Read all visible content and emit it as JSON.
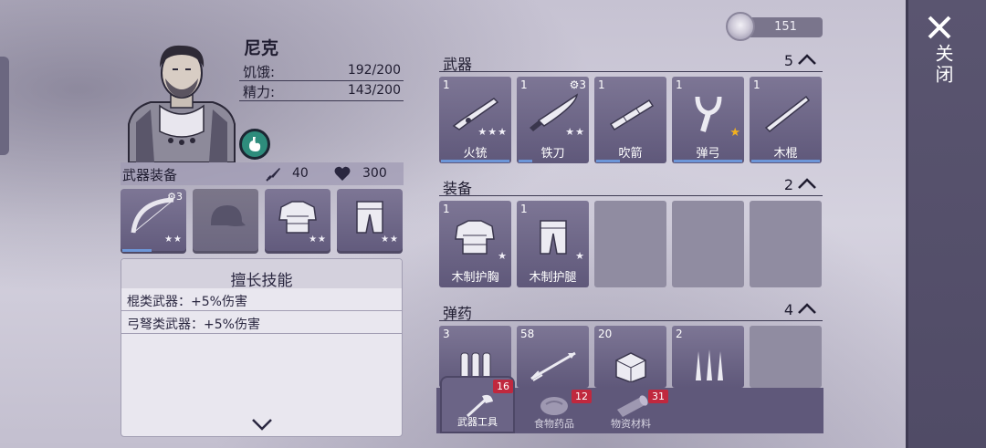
{
  "character": {
    "name": "尼克",
    "hunger_label": "饥饿:",
    "hunger_value": "192/200",
    "energy_label": "精力:",
    "energy_value": "143/200"
  },
  "equipment": {
    "title": "武器装备",
    "attack": "40",
    "health": "300",
    "slots": [
      {
        "name": "bow",
        "icon": "bow-icon",
        "gear_level": "3",
        "stars": 2,
        "durability": 0.45
      },
      {
        "name": "cap",
        "icon": "cap-icon",
        "empty": true
      },
      {
        "name": "chest-armor",
        "icon": "chest-armor-icon",
        "stars": 2
      },
      {
        "name": "leg-armor",
        "icon": "leg-armor-icon",
        "stars": 2
      }
    ]
  },
  "skills": {
    "title": "擅长技能",
    "items": [
      "棍类武器：+5%伤害",
      "弓弩类武器：+5%伤害"
    ]
  },
  "currency": {
    "amount": "151",
    "icon": "coin-icon"
  },
  "inventory": {
    "weapons": {
      "title": "武器",
      "count": "5",
      "items": [
        {
          "qty": "1",
          "name": "火铳",
          "icon": "musket-icon",
          "stars": 3,
          "durability": 1.0
        },
        {
          "qty": "1",
          "name": "铁刀",
          "icon": "knife-icon",
          "stars": 2,
          "gear": "3",
          "durability": 0.2
        },
        {
          "qty": "1",
          "name": "吹箭",
          "icon": "blowgun-icon",
          "durability": 0.35
        },
        {
          "qty": "1",
          "name": "弹弓",
          "icon": "slingshot-icon",
          "gold_star": true,
          "durability": 1.0
        },
        {
          "qty": "1",
          "name": "木棍",
          "icon": "stick-icon",
          "durability": 1.0
        }
      ]
    },
    "equipment": {
      "title": "装备",
      "count": "2",
      "items": [
        {
          "qty": "1",
          "name": "木制护胸",
          "icon": "chest-armor-icon",
          "stars": 1
        },
        {
          "qty": "1",
          "name": "木制护腿",
          "icon": "leg-armor-icon",
          "stars": 1
        }
      ]
    },
    "ammo": {
      "title": "弹药",
      "count": "4",
      "items": [
        {
          "qty": "3",
          "icon": "darts-icon"
        },
        {
          "qty": "58",
          "icon": "arrow-icon"
        },
        {
          "qty": "20",
          "icon": "ammo-box-icon"
        },
        {
          "qty": "2",
          "icon": "spikes-icon"
        }
      ]
    }
  },
  "tabs": [
    {
      "label": "武器工具",
      "badge": "16",
      "icon": "axe-icon",
      "active": true
    },
    {
      "label": "食物药品",
      "badge": "12",
      "icon": "meat-icon"
    },
    {
      "label": "物资材料",
      "badge": "31",
      "icon": "log-icon"
    }
  ],
  "close": {
    "label": "关闭"
  },
  "colors": {
    "accent_bar": "#6d96d8",
    "badge": "#c0283e",
    "gold_star": "#f3b11d"
  }
}
